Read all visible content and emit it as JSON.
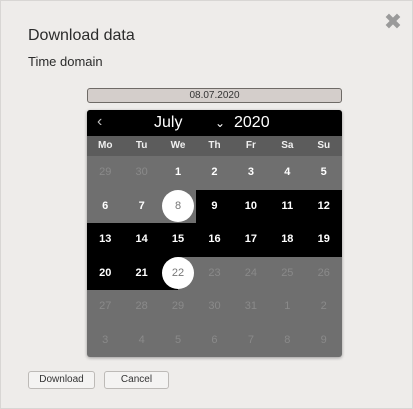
{
  "dialog": {
    "title": "Download data",
    "subtitle": "Time domain",
    "close_icon": "close-icon"
  },
  "date_input": {
    "value": "08.07.2020"
  },
  "calendar": {
    "prev_icon": "chevron-left-icon",
    "month": "July",
    "year": "2020",
    "weekdays": [
      "Mo",
      "Tu",
      "We",
      "Th",
      "Fr",
      "Sa",
      "Su"
    ],
    "weeks": [
      [
        "29",
        "30",
        "1",
        "2",
        "3",
        "4",
        "5"
      ],
      [
        "6",
        "7",
        "8",
        "9",
        "10",
        "11",
        "12"
      ],
      [
        "13",
        "14",
        "15",
        "16",
        "17",
        "18",
        "19"
      ],
      [
        "20",
        "21",
        "22",
        "23",
        "24",
        "25",
        "26"
      ],
      [
        "27",
        "28",
        "29",
        "30",
        "31",
        "1",
        "2"
      ],
      [
        "3",
        "4",
        "5",
        "6",
        "7",
        "8",
        "9"
      ]
    ],
    "range_start": "8",
    "range_end": "22"
  },
  "buttons": {
    "download": "Download",
    "cancel": "Cancel"
  },
  "colors": {
    "range_highlight": "#000000",
    "selected_circle": "#ffffff",
    "calendar_bg": "#6f6f6f"
  }
}
